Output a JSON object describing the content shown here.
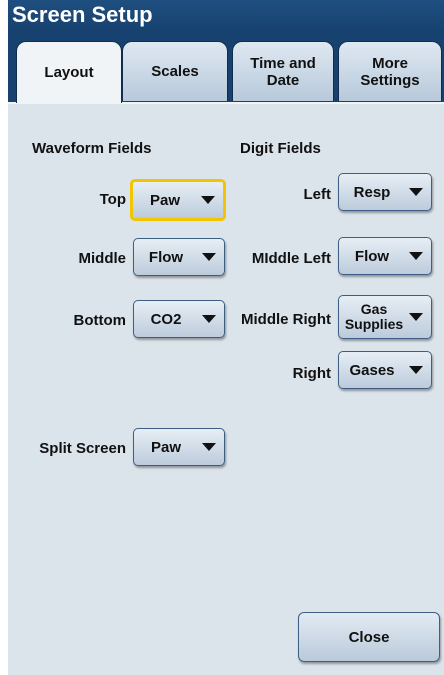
{
  "window": {
    "title": "Screen Setup"
  },
  "tabs": [
    {
      "label": "Layout",
      "active": true
    },
    {
      "label": "Scales",
      "active": false
    },
    {
      "label": "Time and\nDate",
      "active": false
    },
    {
      "label": "More\nSettings",
      "active": false
    }
  ],
  "waveform": {
    "heading": "Waveform Fields",
    "top": {
      "label": "Top",
      "value": "Paw"
    },
    "middle": {
      "label": "Middle",
      "value": "Flow"
    },
    "bottom": {
      "label": "Bottom",
      "value": "CO2"
    }
  },
  "digits": {
    "heading": "Digit Fields",
    "left": {
      "label": "Left",
      "value": "Resp"
    },
    "middle_left": {
      "label": "MIddle Left",
      "value": "Flow"
    },
    "middle_right": {
      "label": "Middle Right",
      "value": "Gas\nSupplies"
    },
    "right": {
      "label": "Right",
      "value": "Gases"
    }
  },
  "split_screen": {
    "label": "Split Screen",
    "value": "Paw"
  },
  "buttons": {
    "close": "Close"
  },
  "icons": {
    "dropdown": "chevron-down-icon"
  },
  "colors": {
    "title_bar": "#174270",
    "focus": "#f3c400",
    "panel": "#dbe3eb"
  }
}
